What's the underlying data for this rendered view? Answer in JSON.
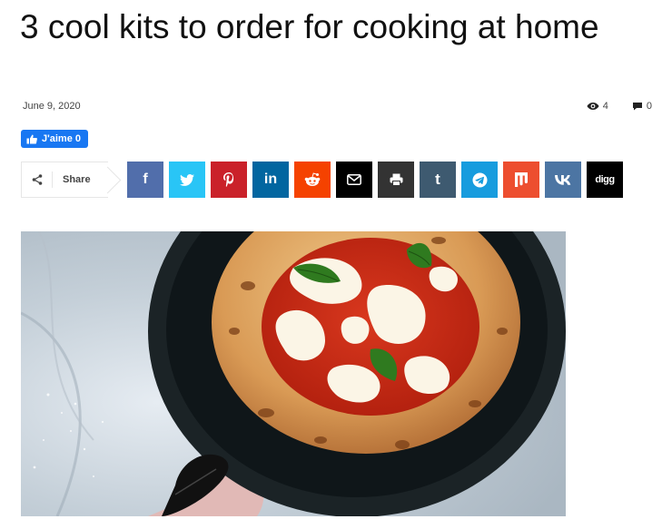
{
  "article": {
    "title": "3 cool kits to order for cooking at home",
    "date": "June 9, 2020",
    "views": "4",
    "comments": "0"
  },
  "like_button": {
    "label": "J'aime 0"
  },
  "share": {
    "label": "Share"
  },
  "social_buttons": [
    {
      "name": "facebook",
      "icon": "facebook-icon",
      "glyph": "f",
      "color": "#516eab"
    },
    {
      "name": "twitter",
      "icon": "twitter-icon",
      "glyph": "",
      "color": "#29c5f6"
    },
    {
      "name": "pinterest",
      "icon": "pinterest-icon",
      "glyph": "P",
      "color": "#ca212a"
    },
    {
      "name": "linkedin",
      "icon": "linkedin-icon",
      "glyph": "in",
      "color": "#0266a0"
    },
    {
      "name": "reddit",
      "icon": "reddit-icon",
      "glyph": "",
      "color": "#f54200"
    },
    {
      "name": "email",
      "icon": "mail-icon",
      "glyph": "",
      "color": "#000000"
    },
    {
      "name": "print",
      "icon": "printer-icon",
      "glyph": "",
      "color": "#333333"
    },
    {
      "name": "tumblr",
      "icon": "tumblr-icon",
      "glyph": "t",
      "color": "#3e5a70"
    },
    {
      "name": "telegram",
      "icon": "telegram-icon",
      "glyph": "",
      "color": "#179cde"
    },
    {
      "name": "mix",
      "icon": "mix-icon",
      "glyph": "m",
      "color": "#ed4e2f"
    },
    {
      "name": "vk",
      "icon": "vk-icon",
      "glyph": "vk",
      "color": "#4c75a3"
    },
    {
      "name": "digg",
      "icon": "digg-icon",
      "glyph": "digg",
      "color": "#000000"
    }
  ],
  "colors": {
    "like_blue": "#1877f2",
    "text_dark": "#111111",
    "meta_gray": "#444444"
  }
}
